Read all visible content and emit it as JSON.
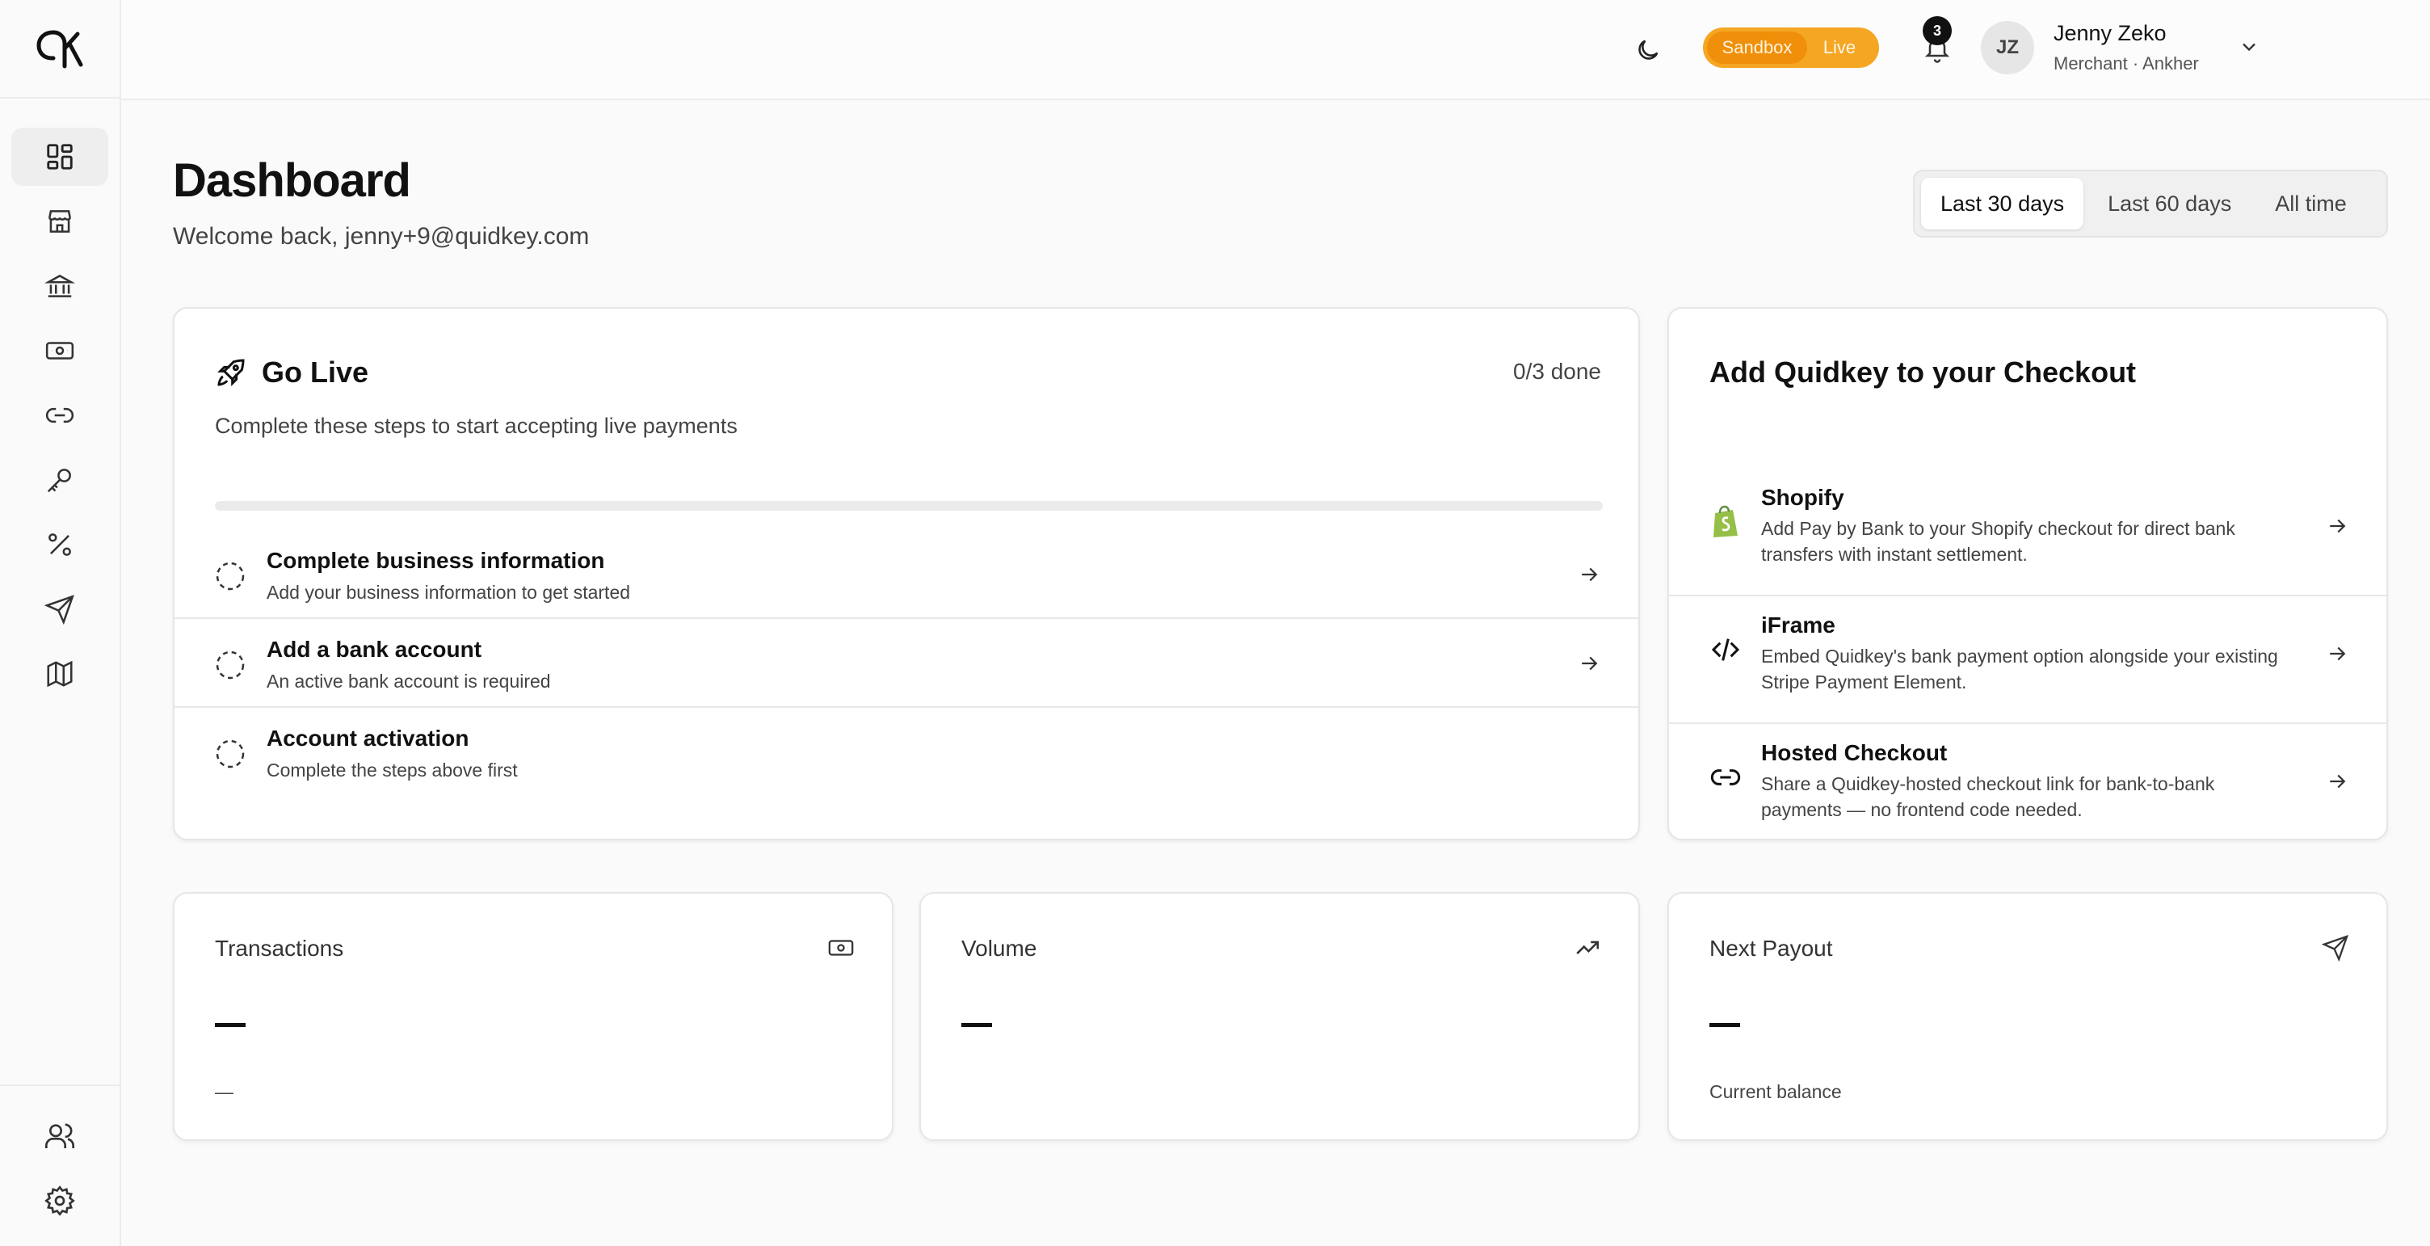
{
  "sidebar": {
    "logo": "qk",
    "items": [
      {
        "name": "dashboard",
        "icon": "dashboard-icon",
        "active": true
      },
      {
        "name": "store",
        "icon": "store-icon"
      },
      {
        "name": "bank",
        "icon": "bank-icon"
      },
      {
        "name": "cash",
        "icon": "cash-icon"
      },
      {
        "name": "links",
        "icon": "link-icon"
      },
      {
        "name": "keys",
        "icon": "key-icon"
      },
      {
        "name": "fees",
        "icon": "percent-icon"
      },
      {
        "name": "payouts",
        "icon": "send-icon"
      },
      {
        "name": "map",
        "icon": "map-icon"
      }
    ],
    "bottom_items": [
      {
        "name": "team",
        "icon": "users-icon"
      },
      {
        "name": "settings",
        "icon": "gear-icon"
      }
    ]
  },
  "topbar": {
    "env_sandbox": "Sandbox",
    "env_live": "Live",
    "env_active": "Sandbox",
    "notification_count": "3",
    "user_initials": "JZ",
    "user_name": "Jenny Zeko",
    "user_role": "Merchant · Ankher"
  },
  "header": {
    "title": "Dashboard",
    "subtitle": "Welcome back, jenny+9@quidkey.com",
    "ranges": [
      "Last 30 days",
      "Last 60 days",
      "All time"
    ],
    "active_range": "Last 30 days"
  },
  "go_live": {
    "title": "Go Live",
    "progress_text": "0/3 done",
    "progress_fraction": 0,
    "description": "Complete these steps to start accepting live payments",
    "steps": [
      {
        "title": "Complete business information",
        "description": "Add your business information to get started",
        "has_arrow": true
      },
      {
        "title": "Add a bank account",
        "description": "An active bank account is required",
        "has_arrow": true
      },
      {
        "title": "Account activation",
        "description": "Complete the steps above first",
        "has_arrow": false
      }
    ]
  },
  "checkout": {
    "title": "Add Quidkey to your Checkout",
    "integrations": [
      {
        "title": "Shopify",
        "description": "Add Pay by Bank to your Shopify checkout for direct bank transfers with instant settlement.",
        "icon": "shopify-icon"
      },
      {
        "title": "iFrame",
        "description": "Embed Quidkey's bank payment option alongside your existing Stripe Payment Element.",
        "icon": "code-icon"
      },
      {
        "title": "Hosted Checkout",
        "description": "Share a Quidkey-hosted checkout link for bank-to-bank payments — no frontend code needed.",
        "icon": "link-icon"
      }
    ]
  },
  "stats": {
    "transactions": {
      "label": "Transactions",
      "sub": "—",
      "icon": "cash-icon"
    },
    "volume": {
      "label": "Volume",
      "icon": "trending-up-icon"
    },
    "next_payout": {
      "label": "Next Payout",
      "sub": "Current balance",
      "icon": "send-icon"
    }
  },
  "colors": {
    "env_toggle": "#f5a623",
    "env_active": "#f08f0a",
    "shopify": "#95bf47"
  }
}
